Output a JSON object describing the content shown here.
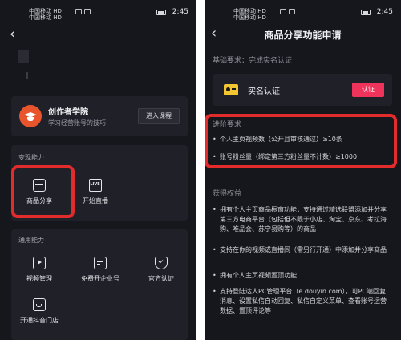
{
  "status_bar": {
    "carrier1": "中国移动 HD",
    "carrier2": "中国移动 HD",
    "time": "2:45"
  },
  "left": {
    "academy": {
      "title": "创作者学院",
      "subtitle": "学习经营账号的技巧",
      "enter_button": "进入课程"
    },
    "monetize": {
      "title": "变现能力",
      "items": [
        {
          "label": "商品分享",
          "icon": "shopping-bag-icon"
        },
        {
          "label": "开始直播",
          "icon": "live-icon"
        }
      ]
    },
    "general": {
      "title": "通用能力",
      "items": [
        {
          "label": "视频管理",
          "icon": "video-icon"
        },
        {
          "label": "免费开企业号",
          "icon": "enterprise-icon"
        },
        {
          "label": "官方认证",
          "icon": "shield-check-icon"
        },
        {
          "label": "开通抖音门店",
          "icon": "store-icon"
        }
      ]
    }
  },
  "right": {
    "title": "商品分享功能申请",
    "basic_requirement": "基础要求：完成实名认证",
    "realname": {
      "label": "实名认证",
      "button": "认证"
    },
    "advanced": {
      "title": "进阶要求",
      "items": [
        "个人主页视频数（公开且审核通过）≥10条",
        "账号粉丝量（绑定第三方粉丝量不计数）≥1000"
      ]
    },
    "benefits": {
      "title": "获得权益",
      "items": [
        "拥有个人主页商品橱窗功能，支持通过精选联盟添加并分享第三方电商平台（包括但不限于小店、淘宝、京东、考拉海购、唯品会、苏宁易购等）的商品",
        "支持在你的视频或直播间（需另行开通）中添加并分享商品",
        "拥有个人主页视频置顶功能",
        "支持登陆达人PC管理平台（e.douyin.com），可PC端回复消息、设置私信自动回复、私信自定义菜单、查看账号运营数据、置顶评论等"
      ]
    }
  },
  "colors": {
    "background": "#16171d",
    "card": "#1f2028",
    "accent_red": "#e22b2b",
    "auth_button": "#f0335a",
    "academy_icon": "#e8552c",
    "id_card_icon": "#f2c531"
  }
}
